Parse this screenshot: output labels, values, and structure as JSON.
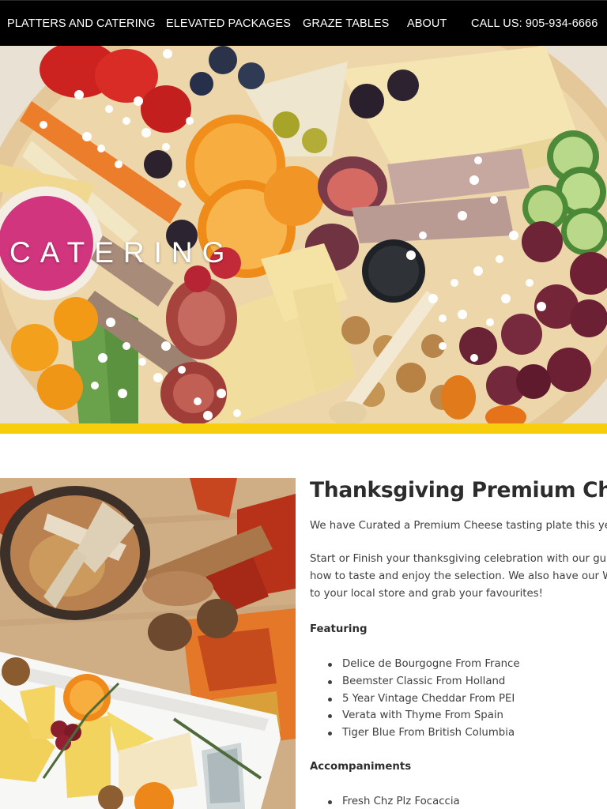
{
  "nav": {
    "items": [
      {
        "label": "PLATTERS AND CATERING"
      },
      {
        "label": "ELEVATED PACKAGES"
      },
      {
        "label": "GRAZE TABLES"
      },
      {
        "label": "ABOUT"
      },
      {
        "label": "CALL US: 905-934-6666"
      }
    ]
  },
  "hero": {
    "title": "CATERING",
    "accent_color": "#f7cd0c"
  },
  "product": {
    "title": "Thanksgiving Premium Chees",
    "intro": "We have Curated a Premium Cheese tasting plate this year for",
    "body_lines": [
      "Start or Finish your thanksgiving celebration with our guided t",
      "how to taste and enjoy the selection. We also have our Wine p",
      "to your local store and grab your favourites!"
    ],
    "featuring": {
      "heading": "Featuring",
      "items": [
        "Delice de Bourgogne From France",
        "Beemster Classic From Holland",
        "5 Year Vintage Cheddar From PEI",
        "Verata with Thyme From Spain",
        "Tiger Blue From British Columbia"
      ]
    },
    "accompaniments": {
      "heading": "Accompaniments",
      "items": [
        "Fresh Chz Plz Focaccia"
      ]
    }
  }
}
